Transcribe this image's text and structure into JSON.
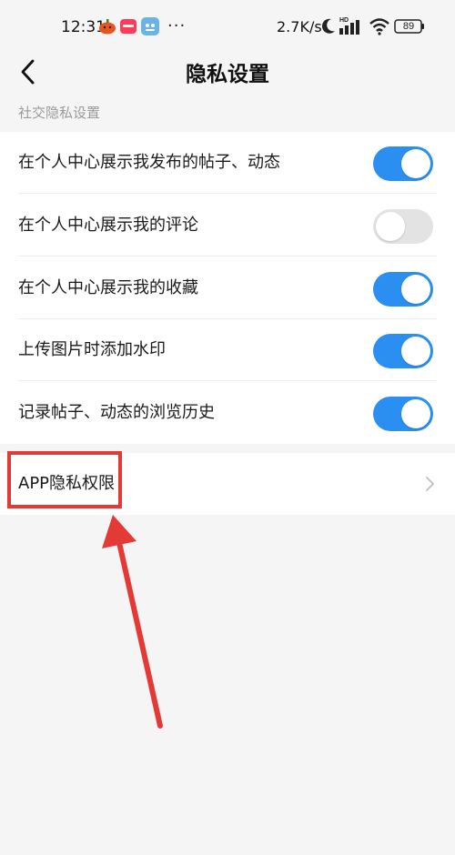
{
  "status_bar": {
    "time": "12:31",
    "network_speed": "2.7K/s",
    "battery": "89",
    "more": "···"
  },
  "header": {
    "title": "隐私设置"
  },
  "section": {
    "label": "社交隐私设置"
  },
  "settings": [
    {
      "label": "在个人中心展示我发布的帖子、动态",
      "enabled": true
    },
    {
      "label": "在个人中心展示我的评论",
      "enabled": false
    },
    {
      "label": "在个人中心展示我的收藏",
      "enabled": true
    },
    {
      "label": "上传图片时添加水印",
      "enabled": true
    },
    {
      "label": "记录帖子、动态的浏览历史",
      "enabled": true
    }
  ],
  "app_privacy": {
    "label": "APP隐私权限"
  },
  "colors": {
    "toggle_on": "#2b8ff2",
    "toggle_off": "#e3e3e3",
    "annotation": "#e53935"
  }
}
